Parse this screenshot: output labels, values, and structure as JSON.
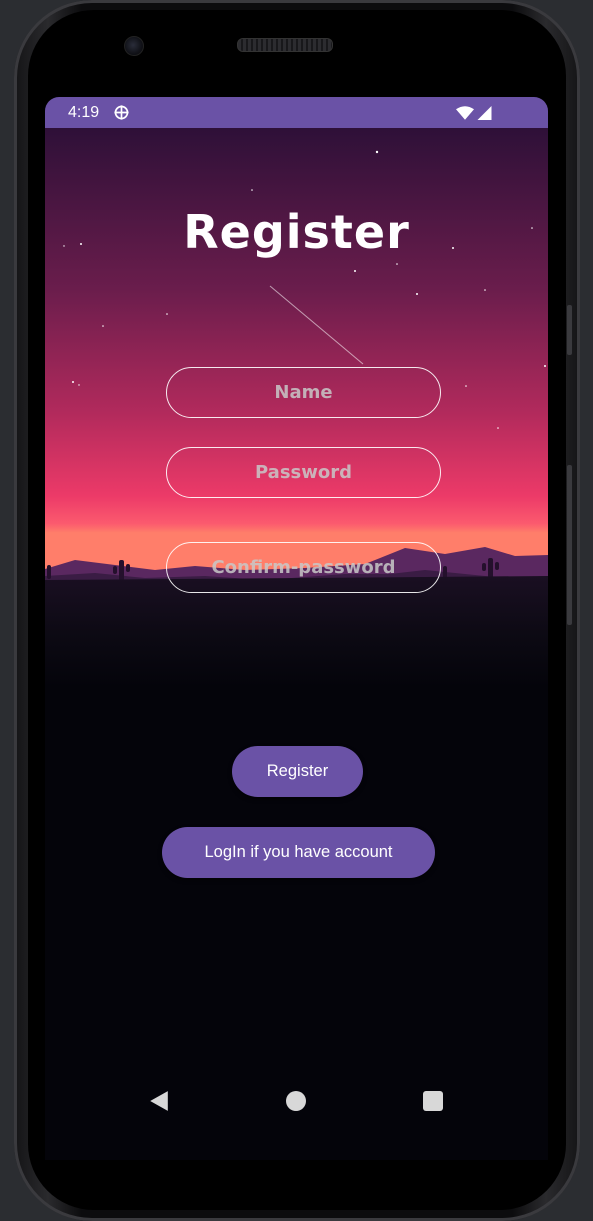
{
  "status_bar": {
    "time": "4:19",
    "icons": [
      "settings-gear-icon",
      "wifi-icon",
      "cell-signal-icon"
    ]
  },
  "screen": {
    "title": "Register",
    "fields": {
      "name_placeholder": "Name",
      "password_placeholder": "Password",
      "confirm_password_placeholder": "Confirm-password"
    },
    "buttons": {
      "register_label": "Register",
      "login_label": "LogIn if you have account"
    }
  },
  "nav_bar": {
    "icons": [
      "back-icon",
      "home-icon",
      "recents-icon"
    ]
  },
  "colors": {
    "accent": "#6a52a6",
    "sky_top": "#2e1038",
    "sky_mid": "#9a2a5c",
    "sky_horizon": "#f5406a",
    "ground": "#04040a"
  }
}
